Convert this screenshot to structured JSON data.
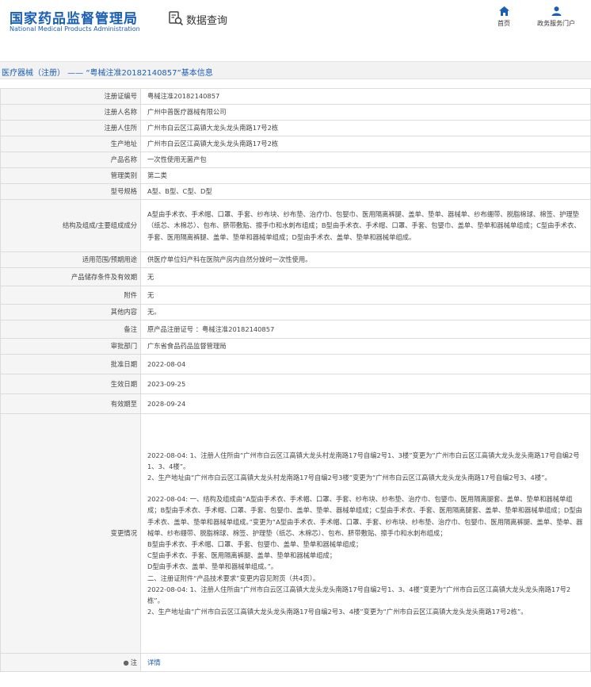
{
  "header": {
    "logo_cn": "国家药品监督管理局",
    "logo_en": "National Medical Products Administration",
    "query_label": "数据查询",
    "nav": [
      {
        "label": "首页",
        "icon": "home-icon"
      },
      {
        "label": "政务服务门户",
        "icon": "user-icon"
      }
    ]
  },
  "section": {
    "title": "医疗器械（注册） —— “粤械注准20182140857”基本信息"
  },
  "rows": [
    {
      "label": "注册证编号",
      "value": "粤械注准20182140857"
    },
    {
      "label": "注册人名称",
      "value": "广州中普医疗器械有限公司"
    },
    {
      "label": "注册人住所",
      "value": "广州市白云区江高镇大龙头龙头南路17号2栋"
    },
    {
      "label": "生产地址",
      "value": "广州市白云区江高镇大龙头龙头南路17号2栋"
    },
    {
      "label": "产品名称",
      "value": "一次性使用无菌产包"
    },
    {
      "label": "管理类别",
      "value": "第二类"
    },
    {
      "label": "型号规格",
      "value": "A型、B型、C型、D型"
    },
    {
      "label": "结构及组成/主要组成成分",
      "value": "A型由手术衣、手术帽、口罩、手套、纱布块、纱布垫、治疗巾、包婴巾、医用隔离裤腿、盖单、垫单、器械单、纱布绷带、脱脂棉球、棉签、护理垫（纸芯、木棉芯）、包布、脐带敷贴、擦手巾和水刺布组成；B型由手术衣、手术帽、口罩、手套、包婴巾、盖单、垫单和器械单组成；C型由手术衣、手套、医用隔离裤腿、盖单、垫单和器械单组成；D型由手术衣、盖单、垫单和器械单组成。"
    },
    {
      "label": "适用范围/预期用途",
      "value": "供医疗单位妇产科在医院产房内自然分娩时一次性使用。"
    },
    {
      "label": "产品储存条件及有效期",
      "value": "无"
    },
    {
      "label": "附件",
      "value": "无"
    },
    {
      "label": "其他内容",
      "value": "无。"
    },
    {
      "label": "备注",
      "value": "原产品注册证号 ：粤械注准20182140857"
    },
    {
      "label": "审批部门",
      "value": "广东省食品药品监督管理局"
    },
    {
      "label": "批准日期",
      "value": "2022-08-04"
    },
    {
      "label": "生效日期",
      "value": "2023-09-25"
    },
    {
      "label": "有效期至",
      "value": "2028-09-24"
    }
  ],
  "change": {
    "label": "变更情况",
    "p1": [
      "2022-08-04: 1、注册人住所由“广州市白云区江高镇大龙头村龙南路17号自编2号1、3楼”变更为“广州市白云区江高镇大龙头龙头南路17号自编2号1、3、4楼”。",
      "2、生产地址由“广州市白云区江高镇大龙头村龙南路17号自编2号3楼”变更为“广州市白云区江高镇大龙头龙头南路17号自编2号3、4楼”。"
    ],
    "p2": [
      "2022-08-04: 一、结构及组成由“A型由手术衣、手术帽、口罩、手套、纱布块、纱布垫、治疗巾、包婴巾、医用隔离腿套、盖单、垫单和器械单组成；B型由手术衣、手术帽、口罩、手套、包婴巾、盖单、垫单、器械单组成；C型由手术衣、手套、医用隔离腿套、盖单、垫单和器械单组成；D型由手术衣、盖单、垫单和器械单组成。”变更为“A型由手术衣、手术帽、口罩、手套、纱布块、纱布垫、治疗巾、包婴巾、医用隔离裤腿、盖单、垫单、器械单、纱布绷带、脱脂棉球、棉签、护理垫（纸芯、木棉芯）、包布、脐带敷贴、擦手巾和水刺布组成；",
      "B型由手术衣、手术帽、口罩、手套、包婴巾、盖单、垫单和器械单组成；",
      "C型由手术衣、手套、医用隔离裤腿、盖单、垫单和器械单组成；",
      "D型由手术衣、盖单、垫单和器械单组成。”。",
      "二、注册证附件“产品技术要求”变更内容见附页（共4页）。",
      "2022-08-04: 1、注册人住所由“广州市白云区江高镇大龙头龙头南路17号自编2号1、3、4楼”变更为“广州市白云区江高镇大龙头龙头南路17号2栋”。",
      "2、生产地址由“广州市白云区江高镇大龙头龙头南路17号自编2号3、4楼”变更为“广州市白云区江高镇大龙头龙头南路17号2栋”。"
    ]
  },
  "footer": {
    "label": "注",
    "link": "详情"
  }
}
